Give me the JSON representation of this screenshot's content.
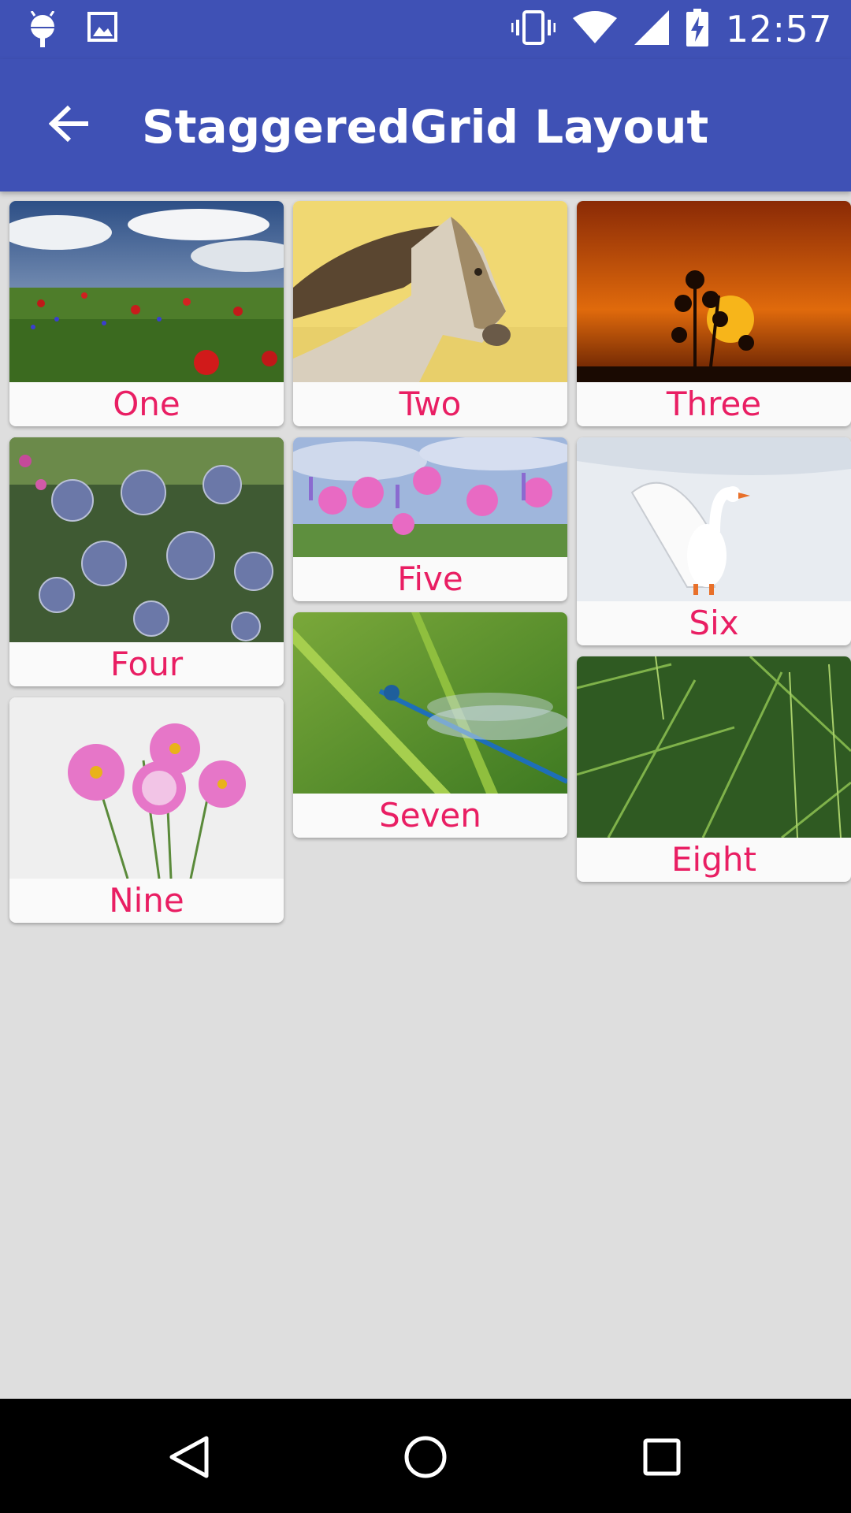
{
  "status_bar": {
    "time": "12:57",
    "left_icons": [
      "android-debug-icon",
      "image-notification-icon"
    ],
    "right_icons": [
      "vibrate-icon",
      "wifi-icon",
      "signal-icon",
      "battery-charging-icon"
    ]
  },
  "toolbar": {
    "title": "StaggeredGrid Layout",
    "back_icon": "arrow-back-icon"
  },
  "colors": {
    "primary": "#3f51b5",
    "accent_text": "#e91e63",
    "background": "#dedede"
  },
  "cards": [
    {
      "label": "One",
      "image": "poppy-meadow"
    },
    {
      "label": "Two",
      "image": "horse"
    },
    {
      "label": "Three",
      "image": "sunset-silhouette"
    },
    {
      "label": "Four",
      "image": "blue-thistles"
    },
    {
      "label": "Five",
      "image": "pink-cosmos-field"
    },
    {
      "label": "Six",
      "image": "white-swan-on-snow"
    },
    {
      "label": "Seven",
      "image": "blue-damselfly"
    },
    {
      "label": "Eight",
      "image": "larch-branches"
    },
    {
      "label": "Nine",
      "image": "pink-cosmos-flowers"
    }
  ],
  "nav_bar": {
    "buttons": [
      "back-triangle-icon",
      "home-circle-icon",
      "recents-square-icon"
    ]
  }
}
